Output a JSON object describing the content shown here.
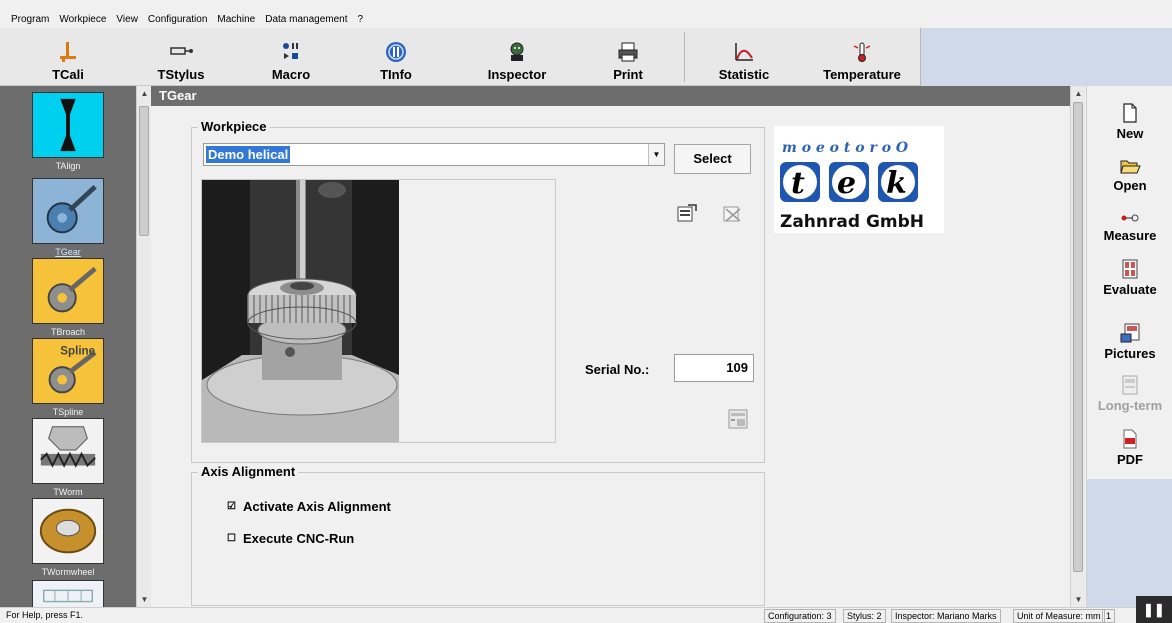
{
  "menu": [
    "Program",
    "Workpiece",
    "View",
    "Configuration",
    "Machine",
    "Data management",
    "?"
  ],
  "toolbar": {
    "buttons": [
      {
        "label": "TCali",
        "icon": "calibration-icon"
      },
      {
        "label": "TStylus",
        "icon": "stylus-icon"
      },
      {
        "label": "Macro",
        "icon": "macro-icon"
      },
      {
        "label": "TInfo",
        "icon": "info-icon"
      },
      {
        "label": "Inspector",
        "icon": "inspector-icon"
      },
      {
        "label": "Print",
        "icon": "printer-icon"
      },
      {
        "label": "Statistic",
        "icon": "statistic-icon"
      },
      {
        "label": "Temperature",
        "icon": "temperature-icon"
      }
    ]
  },
  "sidebar": {
    "items": [
      {
        "label": "TAlign",
        "active": false
      },
      {
        "label": "TGear",
        "active": true
      },
      {
        "label": "TBroach",
        "active": false
      },
      {
        "label": "TSpline",
        "active": false,
        "overlay": "Spline"
      },
      {
        "label": "TWorm",
        "active": false
      },
      {
        "label": "TWormwheel",
        "active": false
      }
    ]
  },
  "main": {
    "title": "TGear",
    "workpiece": {
      "group_title": "Workpiece",
      "selected": "Demo helical",
      "select_label": "Select",
      "serial_label": "Serial No.:",
      "serial_value": "109"
    },
    "axis": {
      "group_title": "Axis Alignment",
      "activate_label": "Activate Axis Alignment",
      "activate_checked": true,
      "cnc_label": "Execute CNC-Run",
      "cnc_checked": false
    }
  },
  "logo": {
    "top": "m o e o t o r o O",
    "letters": [
      "t",
      "e",
      "k"
    ],
    "company": "Zahnrad GmbH"
  },
  "rightbar": {
    "buttons": [
      {
        "label": "New",
        "icon": "new-file-icon",
        "enabled": true
      },
      {
        "label": "Open",
        "icon": "open-folder-icon",
        "enabled": true
      },
      {
        "label": "Measure",
        "icon": "measure-icon",
        "enabled": true
      },
      {
        "label": "Evaluate",
        "icon": "evaluate-icon",
        "enabled": true
      },
      {
        "label": "Pictures",
        "icon": "pictures-icon",
        "enabled": true
      },
      {
        "label": "Long-term",
        "icon": "long-term-icon",
        "enabled": false
      },
      {
        "label": "PDF",
        "icon": "pdf-icon",
        "enabled": true
      }
    ]
  },
  "status": {
    "help": "For Help, press F1.",
    "configuration": "Configuration: 3",
    "stylus": "Stylus: 2",
    "inspector": "Inspector: Mariano Marks",
    "unit": "Unit of Measure: mm",
    "page": "1"
  },
  "colors": {
    "accent": "#3378d6",
    "panel": "#6d6d6d",
    "toolbar_blue": "#cfd9ea",
    "talign_bg": "#00d0f0"
  }
}
